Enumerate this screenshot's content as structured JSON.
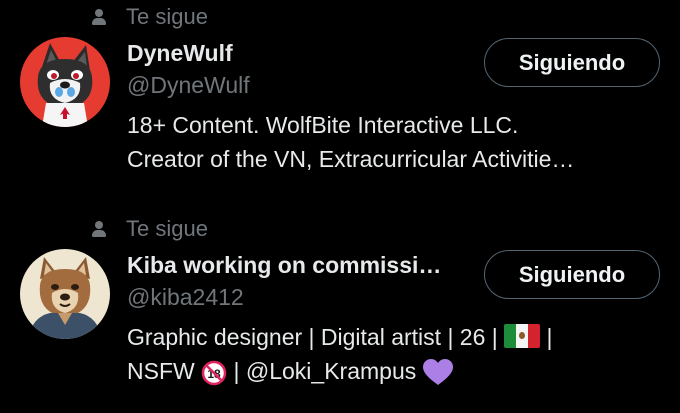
{
  "accounts": [
    {
      "follows_you": "Te sigue",
      "display_name": "DyneWulf",
      "handle": "@DyneWulf",
      "bio_line1": "18+ Content. WolfBite Interactive LLC.",
      "bio_line2": "Creator of the VN, Extracurricular Activitie…",
      "button_label": "Siguiendo",
      "avatar_bg": "#e63b30"
    },
    {
      "follows_you": "Te sigue",
      "display_name": "Kiba working on commissi…",
      "handle": "@kiba2412",
      "bio_line1_text": "Graphic designer | Digital artist | 26 | ",
      "bio_line1_end": " |",
      "bio_line2_a": "NSFW ",
      "bio_line2_b": " | ",
      "bio_mention": "@Loki_Krampus",
      "button_label": "Siguiendo",
      "avatar_bg": "#efe6d2"
    }
  ],
  "icons": [
    "person-icon",
    "no-under-18-icon",
    "mexico-flag-icon",
    "purple-heart-icon"
  ],
  "colors": {
    "background": "#000000",
    "text": "#e7e9ea",
    "muted": "#71767b",
    "button_border": "#536471",
    "heart": "#ab7fe6",
    "no18": "#e0245e"
  }
}
